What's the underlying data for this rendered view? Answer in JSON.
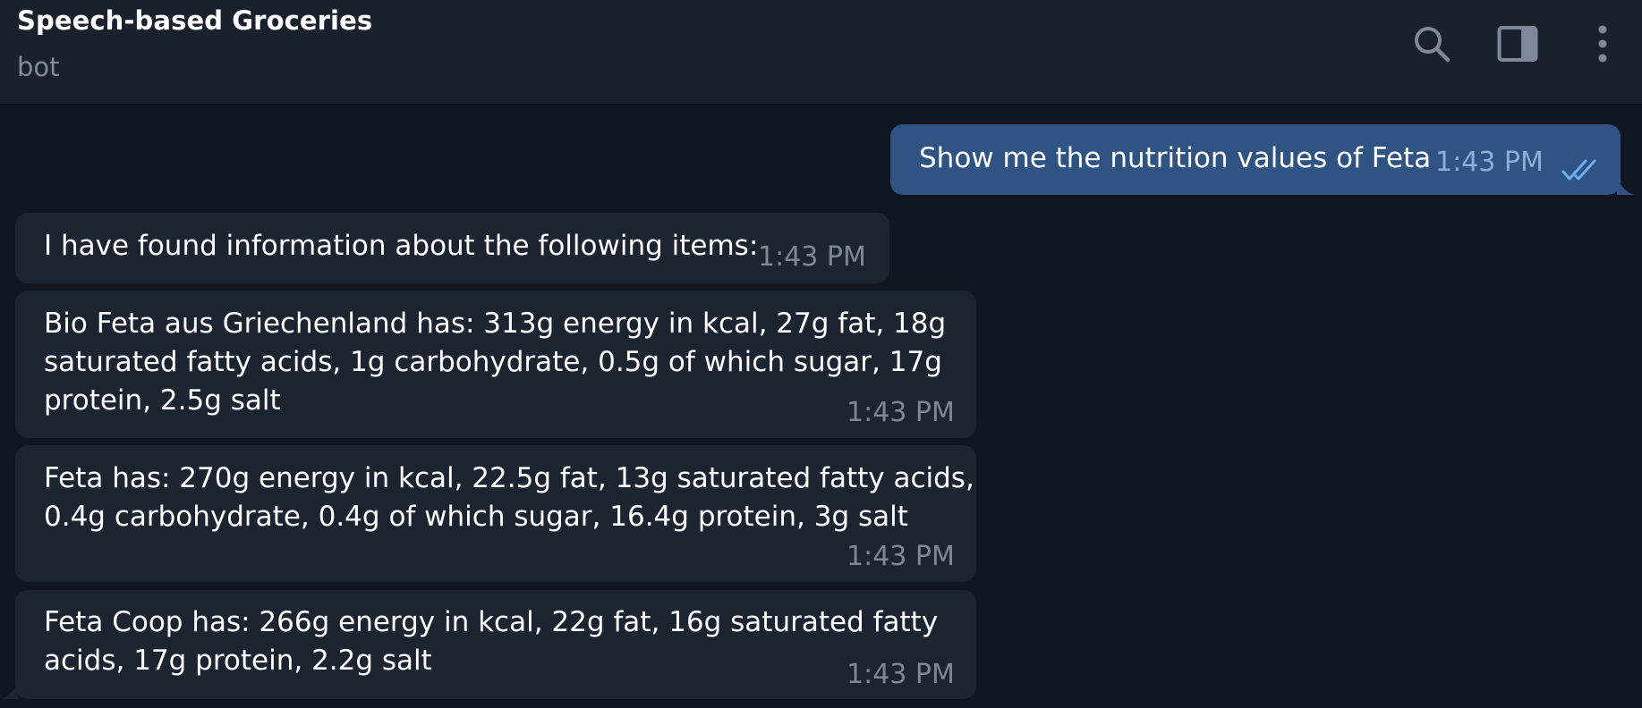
{
  "header": {
    "title": "Speech-based Groceries",
    "subtitle": "bot",
    "actions": {
      "search_icon": "search-icon",
      "sidebar_icon": "sidebar-toggle-icon",
      "more_icon": "more-vertical-icon"
    }
  },
  "messages": [
    {
      "direction": "outgoing",
      "text": "Show me the nutrition values of Feta",
      "time": "1:43 PM",
      "status_icon": "double-check-icon"
    },
    {
      "direction": "incoming",
      "text": "I have found information about the following items:",
      "time": "1:43 PM"
    },
    {
      "direction": "incoming",
      "text": "Bio Feta aus Griechenland has: 313g energy in kcal, 27g fat, 18g\nsaturated fatty acids, 1g carbohydrate, 0.5g of which sugar, 17g\nprotein, 2.5g salt",
      "time": "1:43 PM"
    },
    {
      "direction": "incoming",
      "text": "Feta has: 270g energy in kcal, 22.5g fat, 13g saturated fatty acids,\n0.4g carbohydrate, 0.4g of which sugar, 16.4g protein, 3g salt",
      "time": "1:43 PM"
    },
    {
      "direction": "incoming",
      "text": "Feta Coop has: 266g energy in kcal, 22g fat, 16g saturated fatty\nacids, 17g protein, 2.2g salt",
      "time": "1:43 PM"
    }
  ],
  "colors": {
    "background": "#111722",
    "header_background": "#1b212c",
    "outgoing_bubble": "#2f5382",
    "incoming_bubble": "#1c2431",
    "read_check": "#6fb0f0",
    "muted_text": "#7f8c9b"
  }
}
